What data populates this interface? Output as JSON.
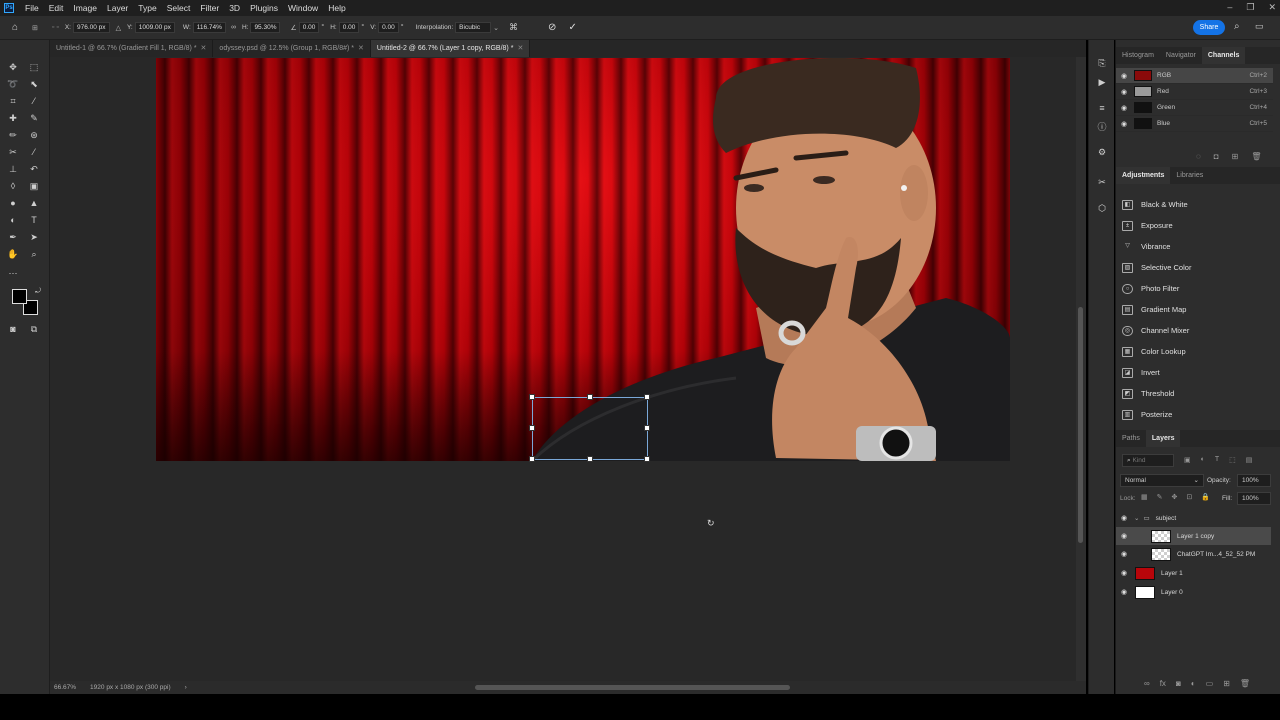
{
  "app": {
    "logo": "Ps",
    "menu": [
      "File",
      "Edit",
      "Image",
      "Layer",
      "Type",
      "Select",
      "Filter",
      "3D",
      "Plugins",
      "Window",
      "Help"
    ],
    "share_label": "Share"
  },
  "options_bar": {
    "x_label": "X:",
    "x_value": "976.00 px",
    "y_label": "Y:",
    "y_value": "1009.00 px",
    "w_label": "W:",
    "w_value": "116.74%",
    "h_label": "H:",
    "h_value": "95.30%",
    "angle_value": "0.00",
    "angle_unit": "°",
    "hskew_label": "H:",
    "hskew_value": "0.00",
    "hskew_unit": "°",
    "vskew_label": "V:",
    "vskew_value": "0.00",
    "vskew_unit": "°",
    "interp_label": "Interpolation:",
    "interp_value": "Bicubic"
  },
  "tabs": [
    {
      "label": "Untitled-1 @ 66.7% (Gradient Fill 1, RGB/8) *",
      "active": false
    },
    {
      "label": "odyssey.psd @ 12.5% (Group 1, RGB/8#) *",
      "active": false
    },
    {
      "label": "Untitled-2 @ 66.7% (Layer 1 copy, RGB/8) *",
      "active": true
    }
  ],
  "status": {
    "zoom": "66.67%",
    "doc_info": "1920 px x 1080 px (300 ppi)"
  },
  "channels_panel": {
    "tabs": [
      "Histogram",
      "Navigator",
      "Channels"
    ],
    "active_tab": "Channels",
    "rows": [
      {
        "name": "RGB",
        "shortcut": "Ctrl+2"
      },
      {
        "name": "Red",
        "shortcut": "Ctrl+3"
      },
      {
        "name": "Green",
        "shortcut": "Ctrl+4"
      },
      {
        "name": "Blue",
        "shortcut": "Ctrl+5"
      }
    ]
  },
  "adjustments_panel": {
    "tabs": [
      "Adjustments",
      "Libraries"
    ],
    "items": [
      "Black & White",
      "Exposure",
      "Vibrance",
      "Selective Color",
      "Photo Filter",
      "Gradient Map",
      "Channel Mixer",
      "Color Lookup",
      "Invert",
      "Threshold",
      "Posterize"
    ]
  },
  "layers_panel": {
    "tabs": [
      "Paths",
      "Layers"
    ],
    "kind_placeholder": "Kind",
    "blend_mode": "Normal",
    "opacity_label": "Opacity:",
    "opacity_value": "100%",
    "lock_label": "Lock:",
    "fill_label": "Fill:",
    "fill_value": "100%",
    "layers": [
      {
        "name": "subject"
      },
      {
        "name": "Layer 1 copy"
      },
      {
        "name": "ChatGPT Im...4_52_52 PM"
      },
      {
        "name": "Layer 1"
      },
      {
        "name": "Layer 0"
      }
    ]
  },
  "colors": {
    "accent": "#1473e6",
    "curtain_red": "#c8050b",
    "panel_bg": "#2d2d2d",
    "canvas_bg": "#282828"
  }
}
